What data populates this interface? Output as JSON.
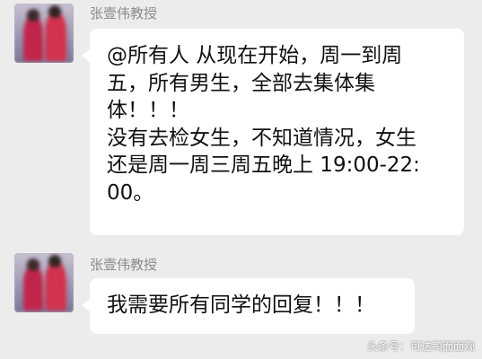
{
  "messages": [
    {
      "sender": "张壹伟教授",
      "lines": [
        "@所有人  从现在开始，周一到周",
        "五，所有男生，全部去集体集",
        "体！！！",
        "没有去检女生，不知道情况，女生",
        "还是周一周三周五晚上 19:00-22:",
        "00。"
      ]
    },
    {
      "sender": "张壹伟教授",
      "lines": [
        "我需要所有同学的回复！！！"
      ]
    }
  ],
  "watermark": "头条号：可达鸭面面观",
  "colors": {
    "background": "#ececec",
    "bubble": "#ffffff",
    "sender_name": "#8a8a8a",
    "text": "#111111"
  }
}
